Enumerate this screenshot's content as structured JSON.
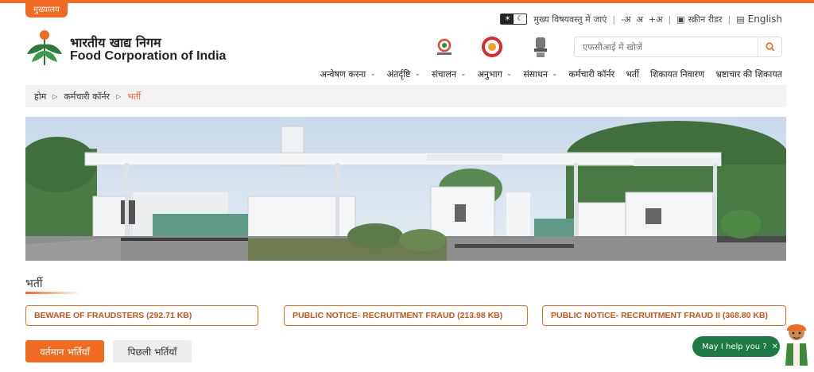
{
  "header": {
    "hq_tab": "मुख्यालय",
    "skip_to_content": "मुख्य विषयवस्तु में जाएं",
    "font_decrease": "-अ",
    "font_normal": "अ",
    "font_increase": "+अ",
    "screen_reader": "स्क्रीन रीडर",
    "language": "English",
    "brand_hindi": "भारतीय खाद्य निगम",
    "brand_english": "Food Corporation of India"
  },
  "search": {
    "placeholder": "एफसीआई में खोजें"
  },
  "nav": [
    {
      "label": "अन्वेषण करना",
      "has_dropdown": true
    },
    {
      "label": "अंतर्दृष्टि",
      "has_dropdown": true
    },
    {
      "label": "संचालन",
      "has_dropdown": true
    },
    {
      "label": "अनुभाग",
      "has_dropdown": true
    },
    {
      "label": "संसाधन",
      "has_dropdown": true
    },
    {
      "label": "कर्मचारी कॉर्नर",
      "has_dropdown": false
    },
    {
      "label": "भर्ती",
      "has_dropdown": false
    },
    {
      "label": "शिकायत निवारण",
      "has_dropdown": false
    },
    {
      "label": "भ्रष्टाचार की शिकायत",
      "has_dropdown": false
    }
  ],
  "breadcrumb": {
    "home": "होम",
    "parent": "कर्मचारी कॉर्नर",
    "current": "भर्ती"
  },
  "section": {
    "title": "भर्ती"
  },
  "notices": [
    "BEWARE OF FRAUDSTERS (292.71 KB)",
    "PUBLIC NOTICE- RECRUITMENT FRAUD (213.98 KB)",
    "PUBLIC NOTICE- RECRUITMENT FRAUD II (368.80 KB)"
  ],
  "tabs": {
    "current": "वर्तमान भर्तियाँ",
    "previous": "पिछली भर्तियाँ"
  },
  "chat": {
    "label": "May I help you ?"
  },
  "colors": {
    "accent": "#f06a22",
    "chat_green": "#1e7a44"
  }
}
